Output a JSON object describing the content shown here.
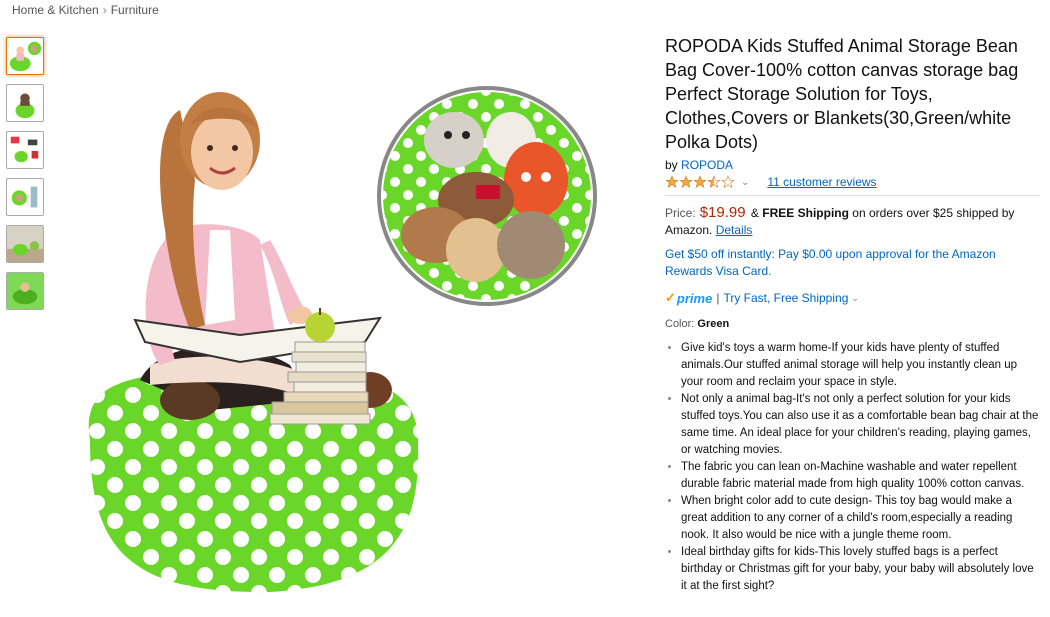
{
  "breadcrumb": {
    "items": [
      "Home & Kitchen",
      "Furniture"
    ],
    "separator": "›"
  },
  "gallery": {
    "thumbnails": [
      "thumb-1",
      "thumb-2",
      "thumb-3",
      "thumb-4",
      "thumb-5",
      "thumb-6"
    ],
    "active_index": 0
  },
  "product": {
    "title": "ROPODA Kids Stuffed Animal Storage Bean Bag Cover-100% cotton canvas storage bag Perfect Storage Solution for Toys, Clothes,Covers or Blankets(30,Green/white Polka Dots)",
    "by_label": "by",
    "brand": "ROPODA",
    "rating": 3.5,
    "reviews_link": "11 customer reviews",
    "price_label": "Price:",
    "price": "$19.99",
    "shipping_amp": "&",
    "shipping_bold": "FREE Shipping",
    "shipping_text": "on orders over $25 shipped by Amazon.",
    "details_link": "Details",
    "promo": "Get $50 off instantly: Pay $0.00 upon approval for the Amazon Rewards Visa Card.",
    "prime_label": "prime",
    "prime_link": "Try Fast, Free Shipping",
    "color_label": "Color:",
    "color_value": "Green",
    "bullets": [
      "Give kid's toys a warm home-If your kids have plenty of stuffed animals.Our stuffed animal storage will help you instantly clean up your room and reclaim your space in style.",
      "Not only a animal bag-It's not only a perfect solution for your kids stuffed toys.You can also use it as a comfortable bean bag chair at the same time. An ideal place for your children's reading, playing games, or watching movies.",
      "The fabric you can lean on-Machine washable and water repellent durable fabric material made from high quality 100% cotton canvas.",
      "When bright color add to cute design- This toy bag would make a great addition to any corner of a child's room,especially a reading nook. It also would be nice with a jungle theme room.",
      "Ideal birthday gifts for kids-This lovely stuffed bags is a perfect birthday or Christmas gift for your baby, your baby will absolutely love it at the first sight?"
    ]
  },
  "colors": {
    "link": "#0066c0",
    "price": "#b12704",
    "bag_green": "#6bd62a",
    "star": "#f3a847"
  }
}
